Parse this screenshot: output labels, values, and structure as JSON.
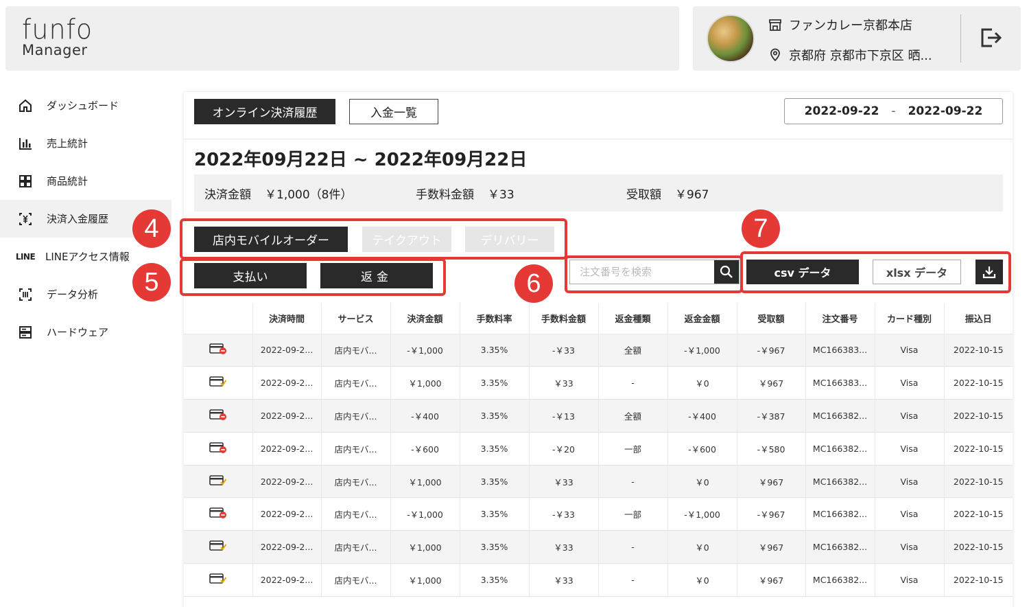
{
  "brand": {
    "logo_main": "funfo",
    "logo_sub": "Manager"
  },
  "store": {
    "name": "ファンカレー京都本店",
    "address": "京都府 京都市下京区 晒..."
  },
  "sidebar": {
    "items": [
      {
        "label": "ダッシュボード",
        "icon": "home-icon"
      },
      {
        "label": "売上統計",
        "icon": "bar-chart-icon"
      },
      {
        "label": "商品統計",
        "icon": "grid-icon"
      },
      {
        "label": "決済入金履歴",
        "icon": "yen-receipt-icon"
      },
      {
        "label": "LINEアクセス情報",
        "icon": "line-icon",
        "icon_text": "LINE"
      },
      {
        "label": "データ分析",
        "icon": "scan-icon"
      },
      {
        "label": "ハードウェア",
        "icon": "hardware-icon"
      }
    ]
  },
  "tabs": {
    "online": "オンライン決済履歴",
    "deposit": "入金一覧"
  },
  "date_range": {
    "start": "2022-09-22",
    "sep": "-",
    "end": "2022-09-22"
  },
  "range_title": "2022年09月22日 ~ 2022年09月22日",
  "summary": {
    "payment_label": "決済金額",
    "payment_value": "￥1,000（8件）",
    "fee_label": "手数料金額",
    "fee_value": "￥33",
    "received_label": "受取額",
    "received_value": "￥967"
  },
  "filters": {
    "instore": "店内モバイルオーダー",
    "takeout": "テイクアウト",
    "delivery": "デリバリー",
    "pay": "支払い",
    "refund": "返金"
  },
  "search": {
    "placeholder": "注文番号を検索"
  },
  "downloads": {
    "csv": "csv データ",
    "xlsx": "xlsx データ"
  },
  "table": {
    "headers": [
      "",
      "決済時間",
      "サービス",
      "決済金額",
      "手数料率",
      "手数料金額",
      "返金種類",
      "返金金額",
      "受取額",
      "注文番号",
      "カード種別",
      "振込日"
    ],
    "rows": [
      [
        "refund",
        "2022-09-2...",
        "店内モバ...",
        "-￥1,000",
        "3.35%",
        "-￥33",
        "全額",
        "-￥1,000",
        "-￥967",
        "MC166383...",
        "Visa",
        "2022-10-15"
      ],
      [
        "pay",
        "2022-09-2...",
        "店内モバ...",
        "￥1,000",
        "3.35%",
        "￥33",
        "-",
        "￥0",
        "￥967",
        "MC166383...",
        "Visa",
        "2022-10-15"
      ],
      [
        "refund",
        "2022-09-2...",
        "店内モバ...",
        "-￥400",
        "3.35%",
        "-￥13",
        "全額",
        "-￥400",
        "-￥387",
        "MC166382...",
        "Visa",
        "2022-10-15"
      ],
      [
        "refund",
        "2022-09-2...",
        "店内モバ...",
        "-￥600",
        "3.35%",
        "-￥20",
        "一部",
        "-￥600",
        "-￥580",
        "MC166382...",
        "Visa",
        "2022-10-15"
      ],
      [
        "pay",
        "2022-09-2...",
        "店内モバ...",
        "￥1,000",
        "3.35%",
        "￥33",
        "-",
        "￥0",
        "￥967",
        "MC166382...",
        "Visa",
        "2022-10-15"
      ],
      [
        "refund",
        "2022-09-2...",
        "店内モバ...",
        "-￥1,000",
        "3.35%",
        "-￥33",
        "一部",
        "-￥1,000",
        "-￥967",
        "MC166382...",
        "Visa",
        "2022-10-15"
      ],
      [
        "pay",
        "2022-09-2...",
        "店内モバ...",
        "￥1,000",
        "3.35%",
        "￥33",
        "-",
        "￥0",
        "￥967",
        "MC166382...",
        "Visa",
        "2022-10-15"
      ],
      [
        "pay",
        "2022-09-2...",
        "店内モバ...",
        "￥1,000",
        "3.35%",
        "￥33",
        "-",
        "￥0",
        "￥967",
        "MC166382...",
        "Visa",
        "2022-10-15"
      ]
    ]
  },
  "annotations": [
    "4",
    "5",
    "6",
    "7"
  ],
  "colors": {
    "dark": "#2a2a2a",
    "annotation": "#e53935",
    "panel": "#efefef",
    "disabled": "#e6e6e6"
  }
}
